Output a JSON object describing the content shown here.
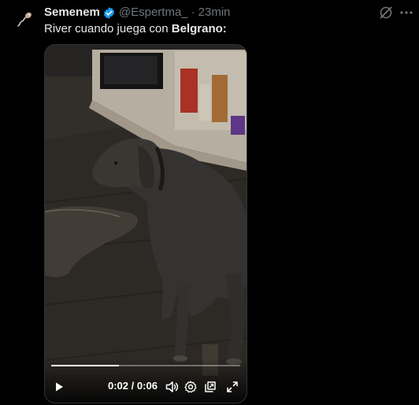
{
  "post": {
    "author": {
      "display_name": "Semenem",
      "handle": "@Espertma_",
      "verified": true,
      "avatar_icon": "sperm-icon"
    },
    "separator": "·",
    "timestamp": "23min",
    "text_prefix": "River cuando juega con",
    "text_bold": "Belgrano:",
    "actions": {
      "grok_icon": "grok-icon",
      "more_icon": "more-icon"
    }
  },
  "video": {
    "time_current": "0:02",
    "time_separator": "/",
    "time_total": "0:06",
    "progress_fraction": 0.36,
    "controls": [
      "play-icon",
      "volume-icon",
      "settings-icon",
      "pip-icon",
      "fullscreen-icon"
    ]
  },
  "colors": {
    "background": "#000000",
    "text_primary": "#e7e9ea",
    "text_secondary": "#71767b",
    "verified_blue": "#1d9bf0",
    "border": "#2f3336"
  }
}
